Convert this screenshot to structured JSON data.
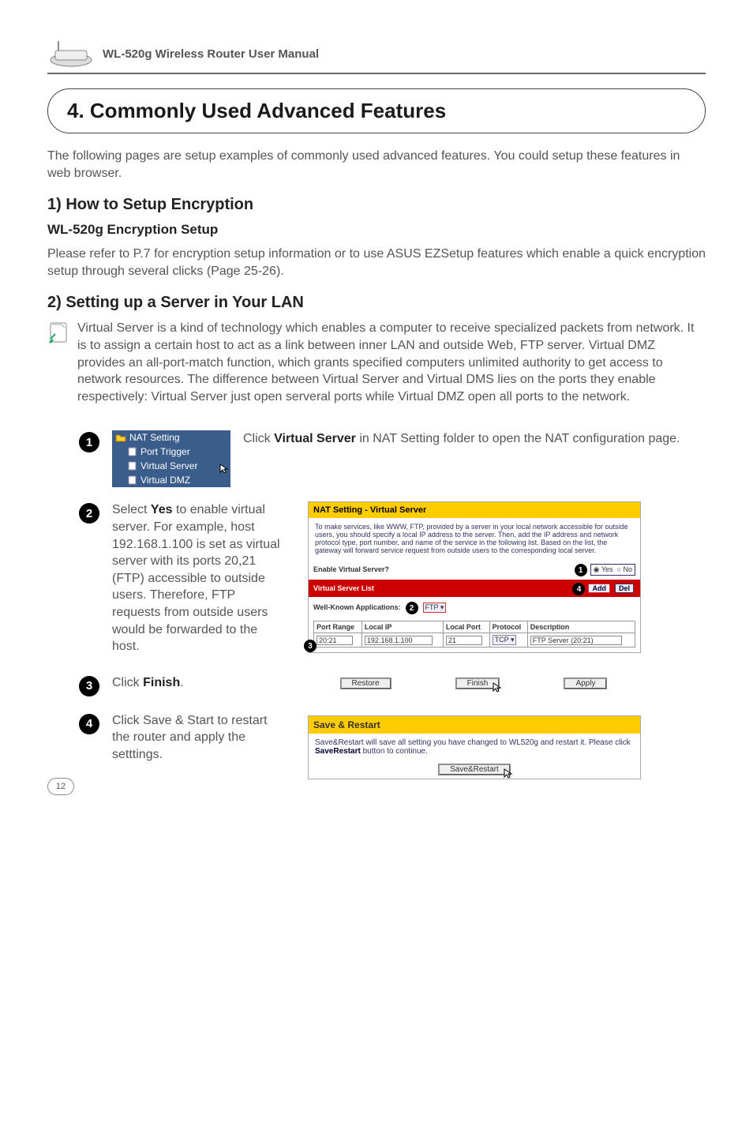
{
  "header": {
    "manual_title": "WL-520g Wireless Router User Manual"
  },
  "chapter": {
    "title": "4. Commonly Used Advanced Features",
    "intro": "The following pages are setup examples of commonly used advanced features. You could setup these features in web browser."
  },
  "sec1": {
    "heading": "1) How to Setup Encryption",
    "sub": "WL-520g Encryption Setup",
    "para": "Please refer to P.7 for encryption setup information or to use ASUS EZSetup features which enable a quick encryption setup through several clicks (Page 25-26)."
  },
  "sec2": {
    "heading": "2) Setting up a Server in Your LAN",
    "para": "Virtual Server is a kind of technology which enables a computer to receive specialized packets from network. It is to assign a certain host to act as a link between inner LAN and outside Web, FTP server. Virtual DMZ provides an all-port-match function, which grants specified computers unlimited authority to get access to network resources. The difference between Virtual Server and Virtual DMS lies on the ports they enable respectively: Virtual Server just open serveral ports while Virtual DMZ open all ports to the network."
  },
  "tree": {
    "folder": "NAT Setting",
    "items": [
      "Port Trigger",
      "Virtual Server",
      "Virtual DMZ"
    ]
  },
  "step1": {
    "pre": "Click ",
    "bold": "Virtual Server",
    "post": " in NAT Setting folder to open the NAT configuration page."
  },
  "step2": {
    "pre": "Select ",
    "bold": "Yes",
    "post": " to enable virtual server. For example, host 192.168.1.100 is set as virtual server with its ports 20,21 (FTP) accessible to outside users. Therefore, FTP requests from outside users would be forwarded to the host."
  },
  "step3": {
    "pre": "Click ",
    "bold": "Finish",
    "post": "."
  },
  "step4": {
    "text": "Click Save & Start to restart the router and apply the setttings."
  },
  "vs_panel": {
    "title": "NAT Setting - Virtual Server",
    "desc": "To make services, like WWW, FTP, provided by a server in your local network accessible for outside users, you should specify a local IP address to the server. Then, add the IP address and network protocol type, port number, and name of the service in the following list. Based on the list, the gateway will forward service request from outside users to the corresponding local server.",
    "enable_label": "Enable Virtual Server?",
    "yes": "Yes",
    "no": "No",
    "list_title": "Virtual Server List",
    "add": "Add",
    "del": "Del",
    "wk_label": "Well-Known Applications:",
    "wk_value": "FTP",
    "cols": [
      "Port Range",
      "Local IP",
      "Local Port",
      "Protocol",
      "Description"
    ],
    "row": [
      "20:21",
      "192.168.1.100",
      "21",
      "TCP",
      "FTP Server (20:21)"
    ]
  },
  "buttons": {
    "restore": "Restore",
    "finish": "Finish",
    "apply": "Apply"
  },
  "save": {
    "title": "Save & Restart",
    "msg_pre": "Save&Restart will save all setting you have changed to WL520g and restart it. Please click ",
    "msg_bold": "SaveRestart",
    "msg_post": " button to continue.",
    "btn": "Save&Restart"
  },
  "page_number": "12"
}
